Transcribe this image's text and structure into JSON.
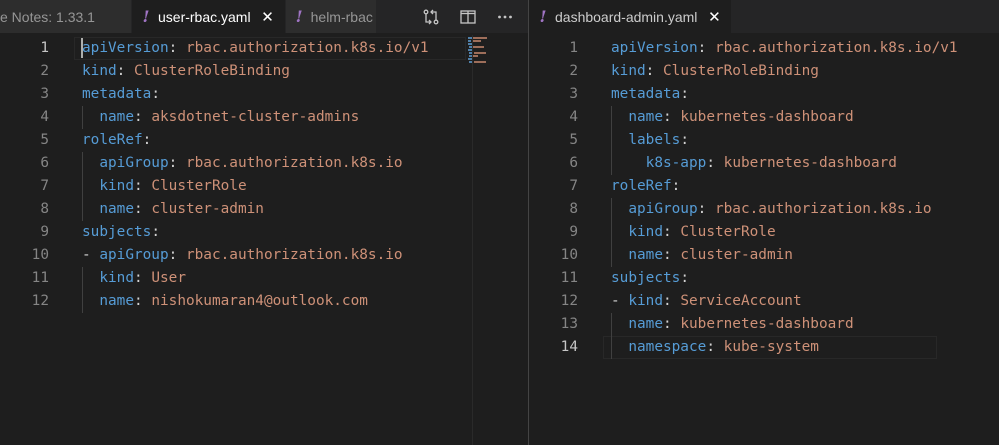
{
  "left_group": {
    "tabs": [
      {
        "label": "e Notes: 1.33.1",
        "active": false,
        "icon": "none"
      },
      {
        "label": "user-rbac.yaml",
        "active": true,
        "icon": "yaml-icon",
        "close": "✕"
      },
      {
        "label": "helm-rbac",
        "active": false,
        "icon": "yaml-icon"
      }
    ],
    "lines": [
      {
        "n": "1",
        "indent": 0,
        "dash": false,
        "key": "apiVersion",
        "value": "rbac.authorization.k8s.io/v1"
      },
      {
        "n": "2",
        "indent": 0,
        "dash": false,
        "key": "kind",
        "value": "ClusterRoleBinding"
      },
      {
        "n": "3",
        "indent": 0,
        "dash": false,
        "key": "metadata",
        "value": ""
      },
      {
        "n": "4",
        "indent": 1,
        "dash": false,
        "key": "name",
        "value": "aksdotnet-cluster-admins"
      },
      {
        "n": "5",
        "indent": 0,
        "dash": false,
        "key": "roleRef",
        "value": ""
      },
      {
        "n": "6",
        "indent": 1,
        "dash": false,
        "key": "apiGroup",
        "value": "rbac.authorization.k8s.io"
      },
      {
        "n": "7",
        "indent": 1,
        "dash": false,
        "key": "kind",
        "value": "ClusterRole"
      },
      {
        "n": "8",
        "indent": 1,
        "dash": false,
        "key": "name",
        "value": "cluster-admin"
      },
      {
        "n": "9",
        "indent": 0,
        "dash": false,
        "key": "subjects",
        "value": ""
      },
      {
        "n": "10",
        "indent": 0,
        "dash": true,
        "key": "apiGroup",
        "value": "rbac.authorization.k8s.io"
      },
      {
        "n": "11",
        "indent": 1,
        "dash": false,
        "key": "kind",
        "value": "User"
      },
      {
        "n": "12",
        "indent": 1,
        "dash": false,
        "key": "name",
        "value": "nishokumaran4@outlook.com"
      }
    ],
    "current_line": "1"
  },
  "right_group": {
    "tabs": [
      {
        "label": "dashboard-admin.yaml",
        "active": false,
        "icon": "yaml-icon",
        "close": "✕"
      }
    ],
    "lines": [
      {
        "n": "1",
        "indent": 0,
        "dash": false,
        "key": "apiVersion",
        "value": "rbac.authorization.k8s.io/v1"
      },
      {
        "n": "2",
        "indent": 0,
        "dash": false,
        "key": "kind",
        "value": "ClusterRoleBinding"
      },
      {
        "n": "3",
        "indent": 0,
        "dash": false,
        "key": "metadata",
        "value": ""
      },
      {
        "n": "4",
        "indent": 1,
        "dash": false,
        "key": "name",
        "value": "kubernetes-dashboard"
      },
      {
        "n": "5",
        "indent": 1,
        "dash": false,
        "key": "labels",
        "value": ""
      },
      {
        "n": "6",
        "indent": 2,
        "dash": false,
        "key": "k8s-app",
        "value": "kubernetes-dashboard"
      },
      {
        "n": "7",
        "indent": 0,
        "dash": false,
        "key": "roleRef",
        "value": ""
      },
      {
        "n": "8",
        "indent": 1,
        "dash": false,
        "key": "apiGroup",
        "value": "rbac.authorization.k8s.io"
      },
      {
        "n": "9",
        "indent": 1,
        "dash": false,
        "key": "kind",
        "value": "ClusterRole"
      },
      {
        "n": "10",
        "indent": 1,
        "dash": false,
        "key": "name",
        "value": "cluster-admin"
      },
      {
        "n": "11",
        "indent": 0,
        "dash": false,
        "key": "subjects",
        "value": ""
      },
      {
        "n": "12",
        "indent": 0,
        "dash": true,
        "key": "kind",
        "value": "ServiceAccount"
      },
      {
        "n": "13",
        "indent": 1,
        "dash": false,
        "key": "name",
        "value": "kubernetes-dashboard"
      },
      {
        "n": "14",
        "indent": 1,
        "dash": false,
        "key": "namespace",
        "value": "kube-system"
      }
    ],
    "current_line": "14"
  },
  "editor_actions": [
    {
      "name": "open-changes-icon"
    },
    {
      "name": "split-editor-icon"
    },
    {
      "name": "more-actions-icon"
    }
  ],
  "colors": {
    "key": "#569cd6",
    "value": "#ce9178",
    "punctuation": "#d4d4d4",
    "line_number": "#858585",
    "yaml_icon": "#a074c4",
    "background": "#1e1e1e"
  }
}
